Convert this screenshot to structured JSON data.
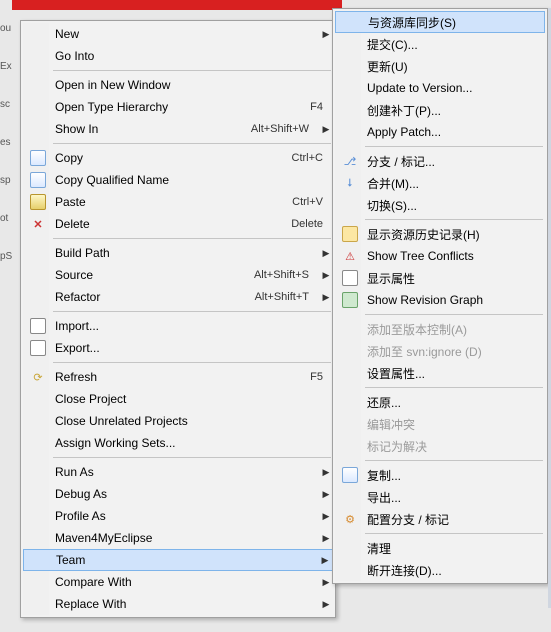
{
  "leftMenu": {
    "groups": [
      [
        {
          "label": "New",
          "accel": "",
          "arrow": true,
          "name": "menu-new"
        },
        {
          "label": "Go Into",
          "name": "menu-go-into"
        }
      ],
      [
        {
          "label": "Open in New Window",
          "name": "menu-open-new-window"
        },
        {
          "label": "Open Type Hierarchy",
          "accel": "F4",
          "name": "menu-open-type-hierarchy"
        },
        {
          "label": "Show In",
          "accel": "Alt+Shift+W",
          "arrow": true,
          "name": "menu-show-in"
        }
      ],
      [
        {
          "label": "Copy",
          "accel": "Ctrl+C",
          "icon": "copy",
          "name": "menu-copy"
        },
        {
          "label": "Copy Qualified Name",
          "icon": "copy",
          "name": "menu-copy-qualified-name"
        },
        {
          "label": "Paste",
          "accel": "Ctrl+V",
          "icon": "paste",
          "name": "menu-paste"
        },
        {
          "label": "Delete",
          "accel": "Delete",
          "icon": "del",
          "name": "menu-delete"
        }
      ],
      [
        {
          "label": "Build Path",
          "arrow": true,
          "name": "menu-build-path"
        },
        {
          "label": "Source",
          "accel": "Alt+Shift+S",
          "arrow": true,
          "name": "menu-source"
        },
        {
          "label": "Refactor",
          "accel": "Alt+Shift+T",
          "arrow": true,
          "name": "menu-refactor"
        }
      ],
      [
        {
          "label": "Import...",
          "icon": "imp",
          "name": "menu-import"
        },
        {
          "label": "Export...",
          "icon": "exp",
          "name": "menu-export"
        }
      ],
      [
        {
          "label": "Refresh",
          "accel": "F5",
          "icon": "ref",
          "name": "menu-refresh"
        },
        {
          "label": "Close Project",
          "name": "menu-close-project"
        },
        {
          "label": "Close Unrelated Projects",
          "name": "menu-close-unrelated"
        },
        {
          "label": "Assign Working Sets...",
          "name": "menu-assign-working-sets"
        }
      ],
      [
        {
          "label": "Run As",
          "arrow": true,
          "name": "menu-run-as"
        },
        {
          "label": "Debug As",
          "arrow": true,
          "name": "menu-debug-as"
        },
        {
          "label": "Profile As",
          "arrow": true,
          "name": "menu-profile-as"
        },
        {
          "label": "Maven4MyEclipse",
          "arrow": true,
          "name": "menu-maven4myeclipse"
        },
        {
          "label": "Team",
          "arrow": true,
          "highlight": true,
          "name": "menu-team"
        },
        {
          "label": "Compare With",
          "arrow": true,
          "name": "menu-compare-with"
        },
        {
          "label": "Replace With",
          "arrow": true,
          "name": "menu-replace-with"
        }
      ]
    ]
  },
  "rightMenu": {
    "groups": [
      [
        {
          "label": "与资源库同步(S)",
          "highlight": true,
          "name": "team-sync-repo"
        },
        {
          "label": "提交(C)...",
          "name": "team-commit"
        },
        {
          "label": "更新(U)",
          "name": "team-update"
        },
        {
          "label": "Update to Version...",
          "name": "team-update-to-version"
        },
        {
          "label": "创建补丁(P)...",
          "name": "team-create-patch"
        },
        {
          "label": "Apply Patch...",
          "name": "team-apply-patch"
        }
      ],
      [
        {
          "label": "分支 / 标记...",
          "icon": "branch",
          "name": "team-branch-tag"
        },
        {
          "label": "合并(M)...",
          "icon": "merge",
          "name": "team-merge"
        },
        {
          "label": "切换(S)...",
          "name": "team-switch"
        }
      ],
      [
        {
          "label": "显示资源历史记录(H)",
          "icon": "hist",
          "name": "team-show-history"
        },
        {
          "label": "Show Tree Conflicts",
          "icon": "tree",
          "name": "team-show-tree-conflicts"
        },
        {
          "label": "显示属性",
          "icon": "props",
          "name": "team-show-properties"
        },
        {
          "label": "Show Revision Graph",
          "icon": "graph",
          "name": "team-show-revision-graph"
        }
      ],
      [
        {
          "label": "添加至版本控制(A)",
          "disabled": true,
          "name": "team-add-version-control"
        },
        {
          "label": "添加至 svn:ignore (D)",
          "disabled": true,
          "name": "team-add-svn-ignore"
        },
        {
          "label": "设置属性...",
          "name": "team-set-property"
        }
      ],
      [
        {
          "label": "还原...",
          "name": "team-revert"
        },
        {
          "label": "编辑冲突",
          "disabled": true,
          "name": "team-edit-conflicts"
        },
        {
          "label": "标记为解决",
          "disabled": true,
          "name": "team-mark-resolved"
        }
      ],
      [
        {
          "label": "复制...",
          "icon": "copy",
          "name": "team-copy"
        },
        {
          "label": "导出...",
          "name": "team-export"
        },
        {
          "label": "配置分支 / 标记",
          "icon": "cfg",
          "name": "team-configure-branches"
        }
      ],
      [
        {
          "label": "清理",
          "name": "team-cleanup"
        },
        {
          "label": "断开连接(D)...",
          "name": "team-disconnect"
        }
      ]
    ]
  },
  "leftStrip": [
    "ou",
    "Ex",
    "sc",
    "es",
    "sp",
    "ot",
    "pS"
  ]
}
